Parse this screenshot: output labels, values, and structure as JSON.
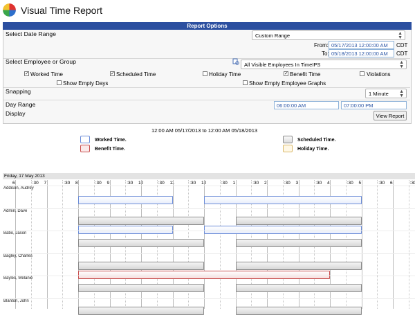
{
  "app": {
    "title": "Visual Time Report"
  },
  "options": {
    "header": "Report Options",
    "date_range": {
      "label": "Select Date Range",
      "value": "Custom Range",
      "from_label": "From:",
      "from_value": "05/17/2013 12:00:00 AM",
      "from_tz": "CDT",
      "to_label": "To:",
      "to_value": "05/18/2013 12:00:00 AM",
      "to_tz": "CDT"
    },
    "employee": {
      "label": "Select Employee or Group",
      "value": "All Visible Employees In TimeIPS"
    },
    "checkboxes": [
      {
        "label": "Worked Time",
        "checked": true
      },
      {
        "label": "Scheduled Time",
        "checked": true
      },
      {
        "label": "Holiday Time",
        "checked": false
      },
      {
        "label": "Benefit Time",
        "checked": true
      },
      {
        "label": "Violations",
        "checked": false
      },
      {
        "label": "Show Empty Days",
        "checked": false
      },
      {
        "label": "Show Empty Employee Graphs",
        "checked": false
      }
    ],
    "snapping": {
      "label": "Snapping",
      "value": "1 Minute"
    },
    "day_range": {
      "label": "Day Range",
      "start": "06:00:00 AM",
      "end": "07:00:00 PM"
    },
    "display": {
      "label": "Display"
    },
    "view_button": "View Report"
  },
  "legend": {
    "range_text": "12:00 AM 05/17/2013 to 12:00 AM 05/18/2013",
    "items": [
      {
        "label": "Worked Time.",
        "color": "#6b8cd8"
      },
      {
        "label": "Scheduled Time.",
        "color": "#8a8a8a"
      },
      {
        "label": "Benefit Time.",
        "color": "#c84f4f"
      },
      {
        "label": "Holiday Time.",
        "color": "#d9b96a"
      }
    ]
  },
  "timeline": {
    "day_label": "Friday, 17 May 2013",
    "hour_labels": [
      "6",
      "7",
      "8",
      "9",
      "10",
      "11",
      "12",
      "1",
      "2",
      "3",
      "4",
      "5",
      "6",
      "7"
    ],
    "half_label": ":30",
    "employees": [
      {
        "name": "Addison, Audrey",
        "bars": [
          {
            "type": "work",
            "start": 8.0,
            "end": 11.0
          },
          {
            "type": "work",
            "start": 12.0,
            "end": 17.0
          }
        ]
      },
      {
        "name": "Admin, Dave",
        "bars": [
          {
            "type": "sched",
            "start": 8.0,
            "end": 12.0
          },
          {
            "type": "sched",
            "start": 13.0,
            "end": 17.0
          },
          {
            "type": "work",
            "start": 8.0,
            "end": 11.0
          },
          {
            "type": "work",
            "start": 12.0,
            "end": 17.0
          }
        ]
      },
      {
        "name": "Babo, Jason",
        "bars": [
          {
            "type": "sched",
            "start": 8.0,
            "end": 12.0
          },
          {
            "type": "sched",
            "start": 13.0,
            "end": 17.0
          }
        ]
      },
      {
        "name": "Bagley, Charles",
        "bars": [
          {
            "type": "sched",
            "start": 8.0,
            "end": 12.0
          },
          {
            "type": "sched",
            "start": 13.0,
            "end": 17.0
          },
          {
            "type": "benefit",
            "start": 8.0,
            "end": 16.0
          }
        ]
      },
      {
        "name": "Bayles, Melanie",
        "bars": [
          {
            "type": "sched",
            "start": 8.0,
            "end": 12.0
          },
          {
            "type": "sched",
            "start": 13.0,
            "end": 17.0
          }
        ]
      },
      {
        "name": "Blanton, John",
        "bars": [
          {
            "type": "sched",
            "start": 8.0,
            "end": 12.0
          },
          {
            "type": "sched",
            "start": 13.0,
            "end": 17.0
          }
        ]
      }
    ]
  }
}
